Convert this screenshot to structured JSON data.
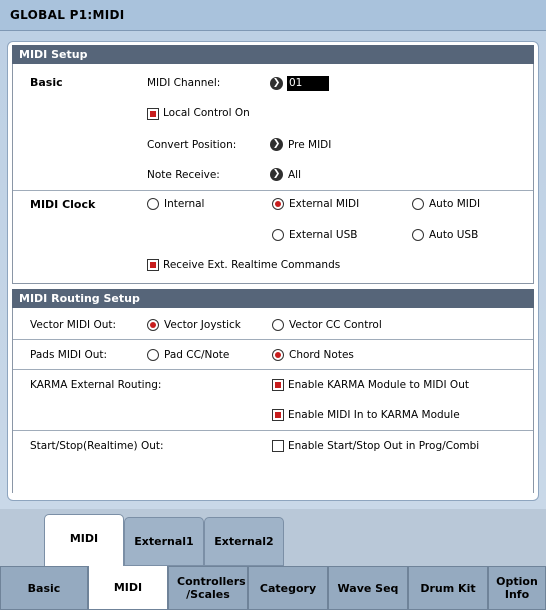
{
  "window": {
    "title": "GLOBAL P1:MIDI"
  },
  "midi_setup": {
    "header": "MIDI Setup",
    "basic_label": "Basic",
    "midi_channel_label": "MIDI Channel:",
    "midi_channel_value": "01",
    "local_control_label": "Local Control On",
    "local_control_checked": true,
    "convert_position_label": "Convert Position:",
    "convert_position_value": "Pre MIDI",
    "note_receive_label": "Note Receive:",
    "note_receive_value": "All",
    "midi_clock_label": "MIDI Clock",
    "clock_options": [
      "Internal",
      "External MIDI",
      "Auto MIDI",
      "External USB",
      "Auto USB"
    ],
    "clock_selected": "External MIDI",
    "receive_realtime_label": "Receive Ext. Realtime Commands",
    "receive_realtime_checked": true
  },
  "routing": {
    "header": "MIDI Routing Setup",
    "vector_label": "Vector MIDI Out:",
    "vector_options": [
      "Vector Joystick",
      "Vector CC Control"
    ],
    "vector_selected": "Vector Joystick",
    "pads_label": "Pads MIDI Out:",
    "pads_options": [
      "Pad CC/Note",
      "Chord Notes"
    ],
    "pads_selected": "Chord Notes",
    "karma_label": "KARMA External Routing:",
    "karma_to_midi_label": "Enable KARMA Module to MIDI Out",
    "karma_to_midi_checked": true,
    "midi_to_karma_label": "Enable MIDI In to KARMA Module",
    "midi_to_karma_checked": true,
    "startstop_label": "Start/Stop(Realtime) Out:",
    "startstop_check_label": "Enable Start/Stop Out in Prog/Combi",
    "startstop_checked": false
  },
  "page_tabs": [
    {
      "label": "MIDI",
      "active": true
    },
    {
      "label": "External1",
      "active": false
    },
    {
      "label": "External2",
      "active": false
    }
  ],
  "bottom_tabs": [
    {
      "label": "Basic",
      "active": false
    },
    {
      "label": "MIDI",
      "active": true
    },
    {
      "label": "Controllers /Scales",
      "active": false
    },
    {
      "label": "Category",
      "active": false
    },
    {
      "label": "Wave Seq",
      "active": false
    },
    {
      "label": "Drum Kit",
      "active": false
    },
    {
      "label": "Option Info",
      "active": false
    }
  ],
  "colors": {
    "title_bar": "#a9c2dc",
    "section_header": "#566579",
    "selection_red": "#c81e1e",
    "tab_inactive": "#95aac0"
  }
}
